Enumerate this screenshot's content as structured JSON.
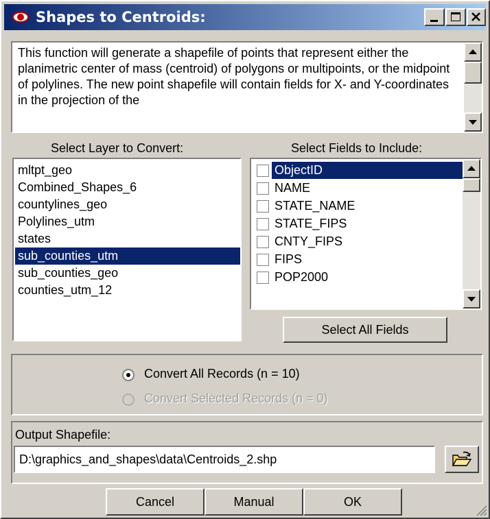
{
  "window": {
    "title": "Shapes to Centroids:",
    "minimize": "_",
    "close": "×"
  },
  "description": "This function will generate a shapefile of points that represent either the planimetric center of mass (centroid) of polygons or multipoints, or the midpoint of polylines.  The new point shapefile will contain fields for X- and Y-coordinates in the projection of the",
  "layers": {
    "label": "Select Layer to Convert:",
    "items": [
      "mltpt_geo",
      "Combined_Shapes_6",
      "countylines_geo",
      "Polylines_utm",
      "states",
      "sub_counties_utm",
      "sub_counties_geo",
      "counties_utm_12"
    ],
    "selected": "sub_counties_utm"
  },
  "fields": {
    "label": "Select Fields to Include:",
    "items": [
      "ObjectID",
      "NAME",
      "STATE_NAME",
      "STATE_FIPS",
      "CNTY_FIPS",
      "FIPS",
      "POP2000"
    ],
    "selected": "ObjectID",
    "select_all": "Select All Fields"
  },
  "records": {
    "all": "Convert All Records (n = 10)",
    "selected": "Convert Selected Records (n = 0)",
    "checked": "all"
  },
  "output": {
    "label": "Output Shapefile:",
    "path": "D:\\graphics_and_shapes\\data\\Centroids_2.shp"
  },
  "buttons": {
    "cancel": "Cancel",
    "manual": "Manual",
    "ok": "OK"
  },
  "icons": {
    "title": "eye-icon",
    "browse": "open-folder-icon"
  },
  "colors": {
    "title_bar": "#0a246a",
    "selection": "#0a246a",
    "face": "#d4d0c8"
  }
}
